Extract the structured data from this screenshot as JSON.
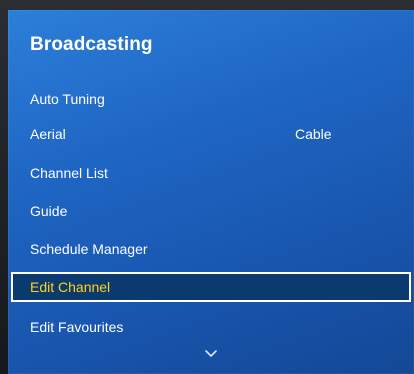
{
  "menu": {
    "title": "Broadcasting",
    "items": [
      {
        "label": "Auto Tuning"
      },
      {
        "label": "Aerial",
        "value": "Cable"
      },
      {
        "label": "Channel List"
      },
      {
        "label": "Guide"
      },
      {
        "label": "Schedule Manager"
      },
      {
        "label": "Edit Channel",
        "selected": true
      },
      {
        "label": "Edit Favourites"
      }
    ],
    "scroll_icon": "chevron-down-icon"
  },
  "colors": {
    "panel": "#1f66c4",
    "highlight_text": "#ffd21a",
    "highlight_bg": "#0b3a6e",
    "text": "#ffffff"
  }
}
